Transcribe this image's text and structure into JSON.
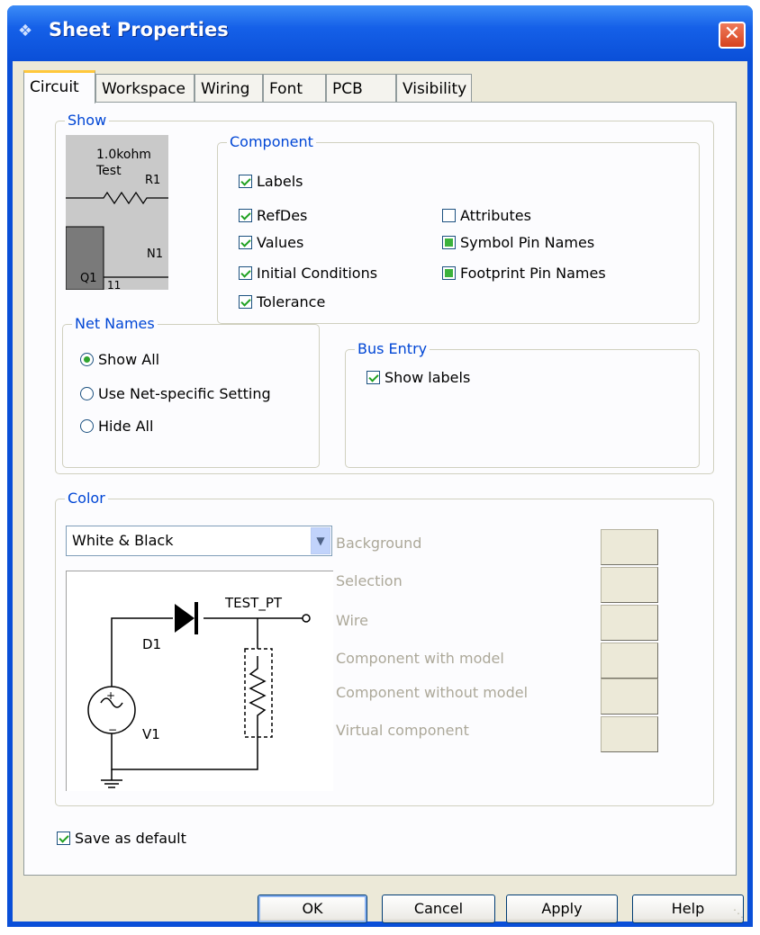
{
  "window": {
    "title": "Sheet Properties",
    "close_label": "✕"
  },
  "tabs": [
    "Circuit",
    "Workspace",
    "Wiring",
    "Font",
    "PCB",
    "Visibility"
  ],
  "show": {
    "legend": "Show",
    "preview": {
      "value_text": "1.0kohm",
      "test_text": "Test",
      "r_label": "R1",
      "net_label": "N1",
      "q_label": "Q1",
      "pin_label": "11"
    },
    "component": {
      "legend": "Component",
      "labels": {
        "label": "Labels",
        "checked": true
      },
      "refdes": {
        "label": "RefDes",
        "checked": true
      },
      "values": {
        "label": "Values",
        "checked": true
      },
      "initial_conditions": {
        "label": "Initial Conditions",
        "checked": true
      },
      "tolerance": {
        "label": "Tolerance",
        "checked": true
      },
      "attributes": {
        "label": "Attributes",
        "checked": false
      },
      "symbol_pin_names": {
        "label": "Symbol Pin Names",
        "state": "indeterminate"
      },
      "footprint_pin_names": {
        "label": "Footprint Pin Names",
        "state": "indeterminate"
      }
    },
    "net_names": {
      "legend": "Net Names",
      "options": [
        "Show All",
        "Use Net-specific Setting",
        "Hide All"
      ],
      "selected": "Show All"
    },
    "bus_entry": {
      "legend": "Bus Entry",
      "show_labels": {
        "label": "Show labels",
        "checked": true
      }
    }
  },
  "color": {
    "legend": "Color",
    "scheme": "White & Black",
    "items": [
      "Background",
      "Selection",
      "Wire",
      "Component with model",
      "Component without model",
      "Virtual component"
    ],
    "preview": {
      "test_pt": "TEST_PT",
      "d1": "D1",
      "v1": "V1"
    }
  },
  "save_as_default": {
    "label": "Save as default",
    "checked": true
  },
  "buttons": {
    "ok": "OK",
    "cancel": "Cancel",
    "apply": "Apply",
    "help": "Help"
  }
}
